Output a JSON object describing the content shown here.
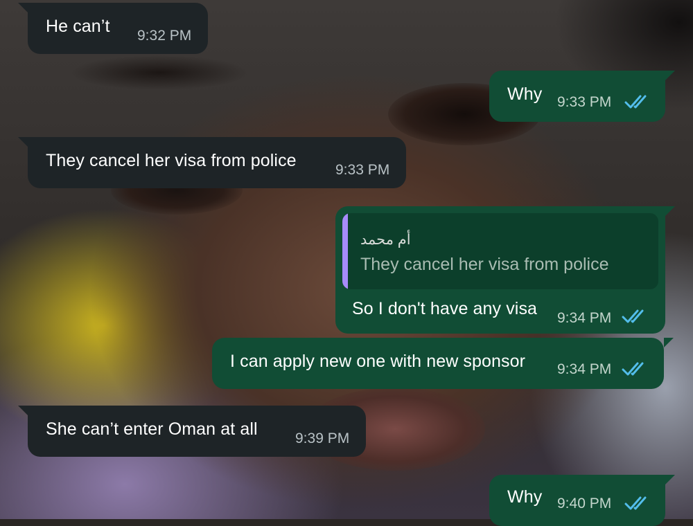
{
  "wallpaper": "selfie-photo",
  "colors": {
    "incoming_bubble": "#1e2427",
    "outgoing_bubble": "#114d35",
    "read_ticks": "#53bdeb",
    "quote_bar": "#a78bfa"
  },
  "messages": [
    {
      "direction": "incoming",
      "text": "He can’t",
      "time": "9:32 PM"
    },
    {
      "direction": "outgoing",
      "text": "Why",
      "time": "9:33 PM",
      "status": "read"
    },
    {
      "direction": "incoming",
      "text": "They cancel her visa from police",
      "time": "9:33 PM"
    },
    {
      "direction": "outgoing",
      "text": "So I don't have any visa",
      "time": "9:34 PM",
      "status": "read",
      "reply_to": {
        "author": "أم محمد",
        "text": "They cancel her visa from police"
      }
    },
    {
      "direction": "outgoing",
      "text": "I can apply new one with new sponsor",
      "time": "9:34 PM",
      "status": "read"
    },
    {
      "direction": "incoming",
      "text": "She can’t enter Oman at all",
      "time": "9:39 PM"
    },
    {
      "direction": "outgoing",
      "text": "Why",
      "time": "9:40 PM",
      "status": "read"
    }
  ]
}
